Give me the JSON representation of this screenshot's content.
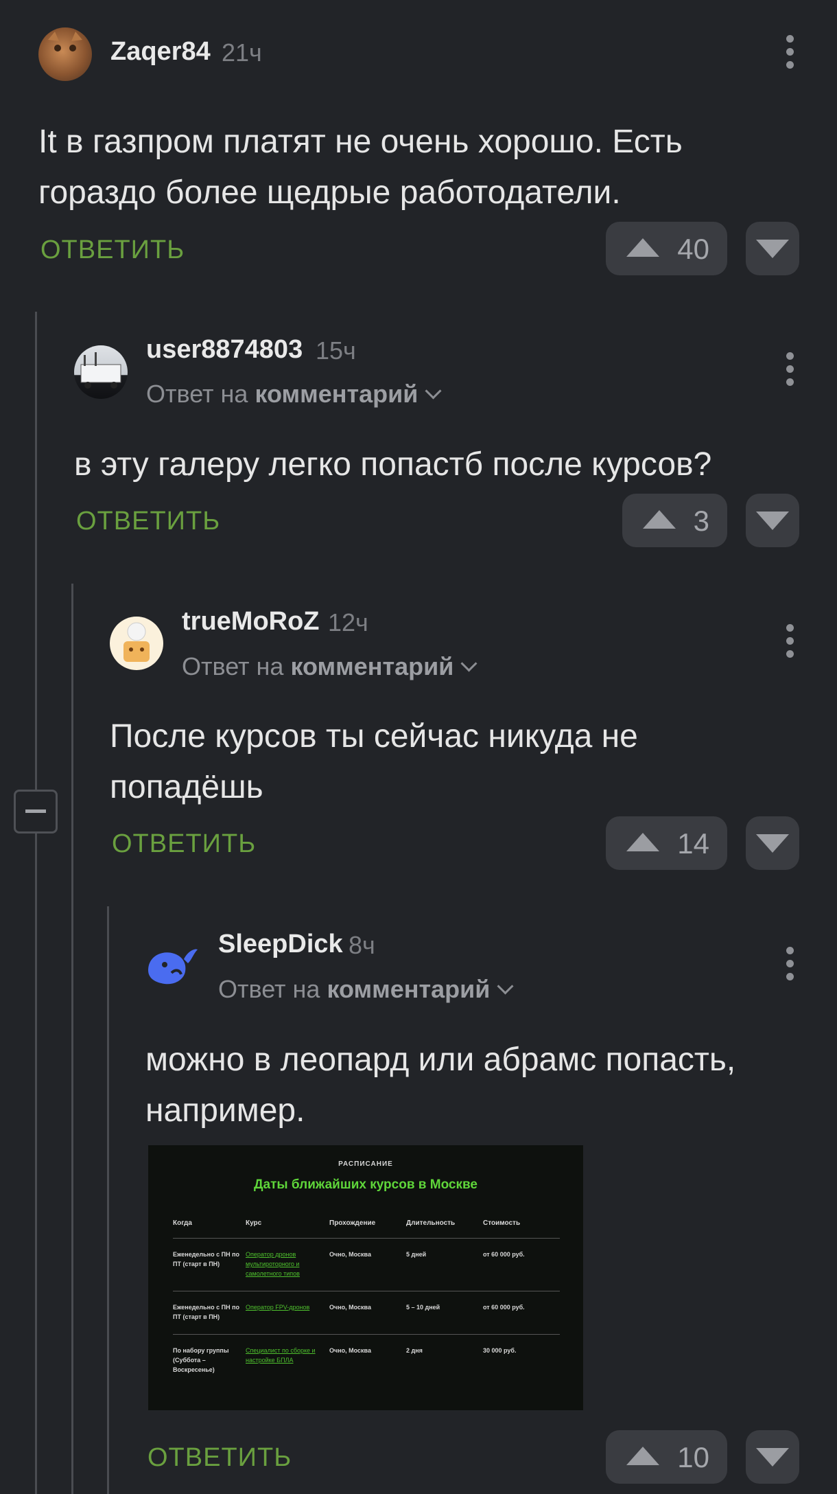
{
  "comments": [
    {
      "author": "Zaqer84",
      "time": "21ч",
      "text": "It в газпром платят не очень хорошо. Есть гораздо более щедрые работодатели.",
      "reply_label": "ОТВЕТИТЬ",
      "score": "40"
    },
    {
      "author": "user8874803",
      "time": "15ч",
      "reply_to_prefix": "Ответ на",
      "reply_to_link": "комментарий",
      "text": "в эту галеру легко попастб после курсов?",
      "reply_label": "ОТВЕТИТЬ",
      "score": "3"
    },
    {
      "author": "trueMoRoZ",
      "time": "12ч",
      "reply_to_prefix": "Ответ на",
      "reply_to_link": "комментарий",
      "text": "После курсов ты сейчас никуда не попадёшь",
      "reply_label": "ОТВЕТИТЬ",
      "score": "14"
    },
    {
      "author": "SleepDick",
      "time": "8ч",
      "reply_to_prefix": "Ответ на",
      "reply_to_link": "комментарий",
      "text": "можно в леопард или абрамс попасть, например.",
      "reply_label": "ОТВЕТИТЬ",
      "score": "10"
    }
  ],
  "schedule_image": {
    "kicker": "РАСПИСАНИЕ",
    "title": "Даты ближайших курсов в Москве",
    "headers": [
      "Когда",
      "Курс",
      "Прохождение",
      "Длительность",
      "Стоимость"
    ],
    "rows": [
      [
        "Еженедельно с ПН по ПТ (старт в ПН)",
        "Оператор дронов мультироторного и самолетного типов",
        "Очно, Москва",
        "5 дней",
        "от 60 000 руб."
      ],
      [
        "Еженедельно с ПН по ПТ (старт в ПН)",
        "Оператор FPV-дронов",
        "Очно, Москва",
        "5 – 10 дней",
        "от 60 000 руб."
      ],
      [
        "По набору группы (Суббота – Воскресенье)",
        "Специалист по сборке и настройке БПЛА",
        "Очно, Москва",
        "2 дня",
        "30 000 руб."
      ]
    ]
  },
  "colors": {
    "background": "#222428",
    "accent_green": "#6aa03f",
    "button_bg": "#3a3c41"
  }
}
